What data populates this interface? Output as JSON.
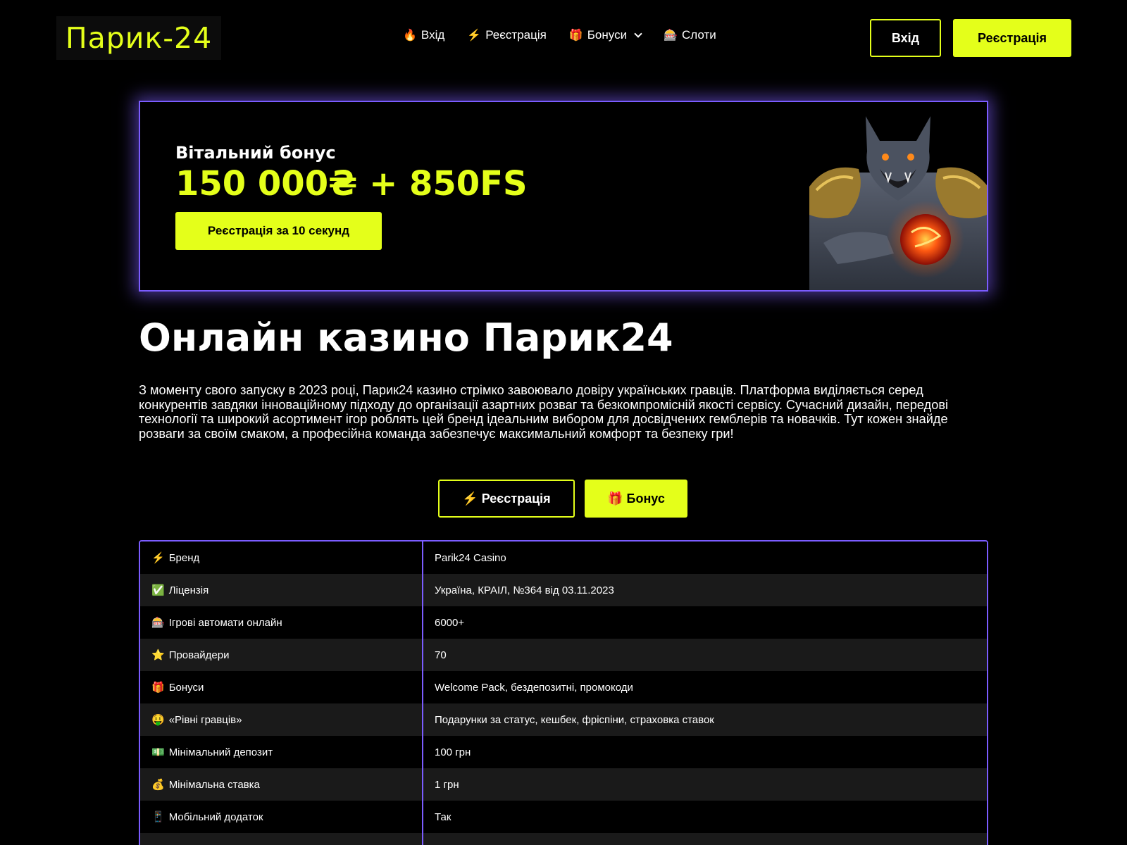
{
  "header": {
    "logo": "Парик-24",
    "nav": [
      {
        "icon": "🔥",
        "label": "Вхід"
      },
      {
        "icon": "⚡",
        "label": "Реєстрація"
      },
      {
        "icon": "🎁",
        "label": "Бонуси"
      },
      {
        "icon": "🎰",
        "label": "Слоти"
      }
    ],
    "login_label": "Вхід",
    "register_label": "Реєстрація"
  },
  "banner": {
    "subtitle": "Вітальний бонус",
    "amount": "150 000₴ + 850FS",
    "cta_label": "Реєстрація за 10 секунд"
  },
  "main": {
    "title": "Онлайн казино Парик24",
    "paragraph": "З моменту свого запуску в 2023 році, Парик24 казино стрімко завоювало довіру українських гравців. Платформа виділяється серед конкурентів завдяки інноваційному підходу до організації азартних розваг та безкомпромісній якості сервісу. Сучасний дизайн, передові технології та широкий асортимент ігор роблять цей бренд ідеальним вибором для досвідчених гемблерів та новачків. Тут кожен знайде розваги за своїм смаком, а професійна команда забезпечує максимальний комфорт та безпеку гри!",
    "btn_register": "⚡ Реєстрація",
    "btn_bonus": "🎁 Бонус"
  },
  "table": [
    {
      "icon": "⚡",
      "label": "Бренд",
      "value": "Parik24 Casino"
    },
    {
      "icon": "✅",
      "label": "Ліцензія",
      "value": "Україна, КРАІЛ, №364 від 03.11.2023"
    },
    {
      "icon": "🎰",
      "label": "Ігрові автомати онлайн",
      "value": "6000+"
    },
    {
      "icon": "⭐",
      "label": "Провайдери",
      "value": "70"
    },
    {
      "icon": "🎁",
      "label": "Бонуси",
      "value": "Welcome Pack, бездепозитні, промокоди"
    },
    {
      "icon": "🤑",
      "label": "«Рівні гравців»",
      "value": "Подарунки за статус, кешбек, фріспіни, страховка ставок"
    },
    {
      "icon": "💵",
      "label": "Мінімальний депозит",
      "value": "100 грн"
    },
    {
      "icon": "💰",
      "label": "Мінімальна ставка",
      "value": "1 грн"
    },
    {
      "icon": "📱",
      "label": "Мобільний додаток",
      "value": "Так"
    },
    {
      "icon": "",
      "label": "",
      "value": ""
    }
  ],
  "colors": {
    "accent": "#e4ff1a",
    "border": "#7b5cff",
    "background": "#000000",
    "row_alt": "#1a1a1a"
  }
}
